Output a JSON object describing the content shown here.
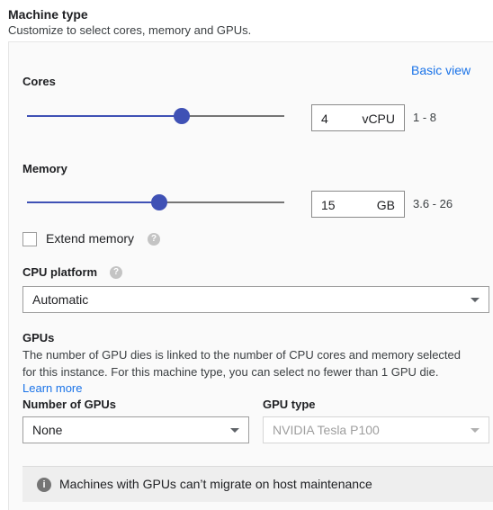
{
  "header": {
    "title": "Machine type",
    "subtitle": "Customize to select cores, memory and GPUs."
  },
  "view_toggle": "Basic view",
  "cores": {
    "label": "Cores",
    "value": "4",
    "unit": "vCPU",
    "range": "1 - 8",
    "slider_fraction": 0.6
  },
  "memory": {
    "label": "Memory",
    "value": "15",
    "unit": "GB",
    "range": "3.6 - 26",
    "slider_fraction": 0.51
  },
  "extend_memory": {
    "label": "Extend memory",
    "checked": false,
    "help_icon": "help-icon"
  },
  "cpu_platform": {
    "label": "CPU platform",
    "help_icon": "help-icon",
    "selected": "Automatic"
  },
  "gpus": {
    "title": "GPUs",
    "description_line1": "The number of GPU dies is linked to the number of CPU cores and memory selected",
    "description_line2": "for this instance. For this machine type, you can select no fewer than 1 GPU die.",
    "learn_more": "Learn more",
    "count_label": "Number of GPUs",
    "count_selected": "None",
    "type_label": "GPU type",
    "type_selected": "NVIDIA Tesla P100"
  },
  "notice": {
    "icon": "info-icon",
    "text": "Machines with GPUs can’t migrate on host maintenance"
  },
  "colors": {
    "accent": "#3f51b5",
    "link": "#1a73e8"
  }
}
